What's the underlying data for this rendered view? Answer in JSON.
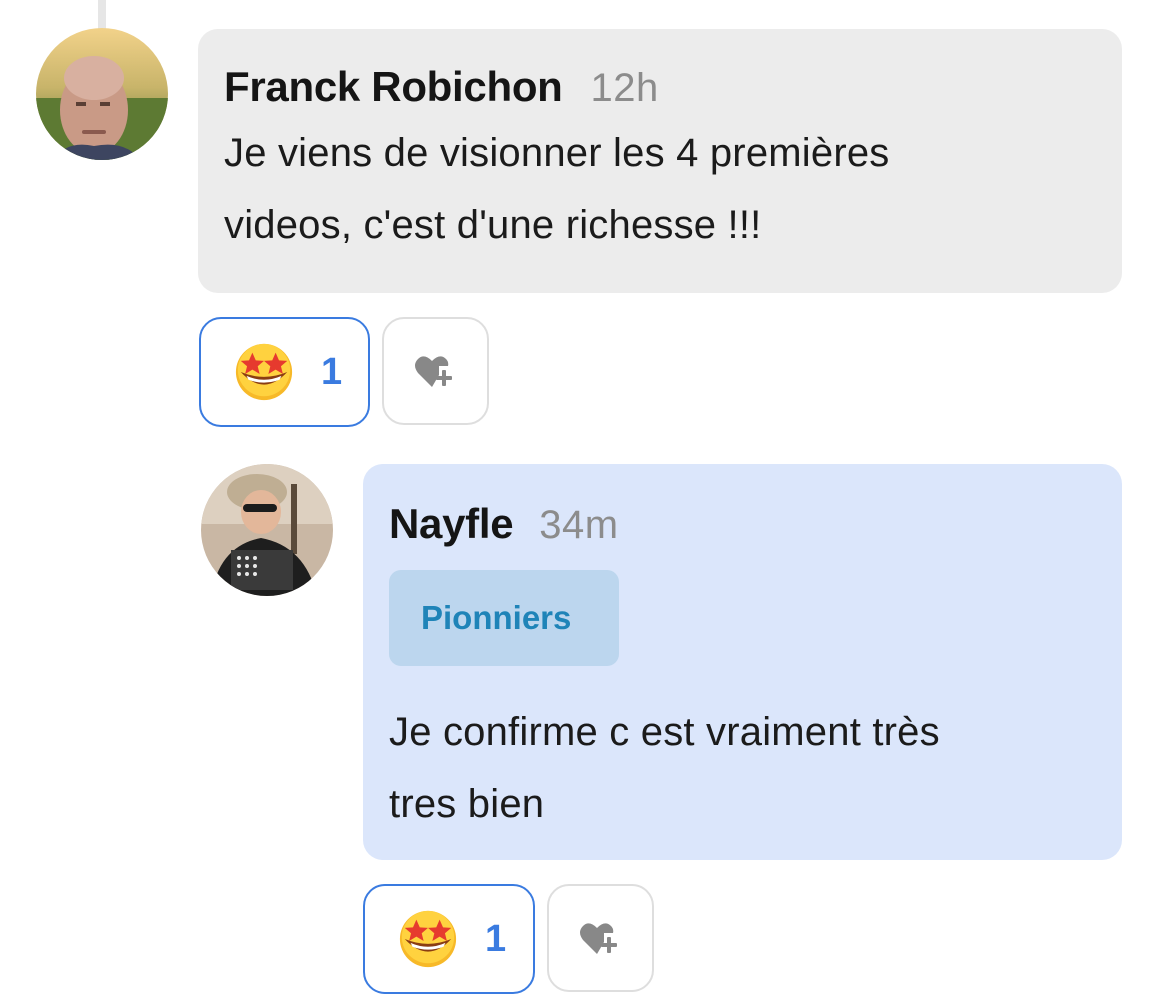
{
  "comments": [
    {
      "author": "Franck Robichon",
      "time": "12h",
      "text_lines": [
        "Je viens de visionner les 4 premières",
        "videos, c'est d'une richesse !!!"
      ],
      "reaction": {
        "emoji": "star-struck",
        "count": "1"
      }
    },
    {
      "author": "Nayfle",
      "time": "34m",
      "tag": "Pionniers",
      "text_lines": [
        "Je confirme c est vraiment très",
        "tres bien"
      ],
      "reaction": {
        "emoji": "star-struck",
        "count": "1"
      }
    }
  ],
  "colors": {
    "accent": "#3a7be0",
    "bubble_grey": "#ececec",
    "bubble_blue": "#dbe6fb",
    "tag_bg": "#bcd6ee",
    "tag_text": "#1f84b8"
  },
  "icons": {
    "add_reaction": "heart-plus-icon",
    "reaction": "star-struck-emoji-icon"
  }
}
